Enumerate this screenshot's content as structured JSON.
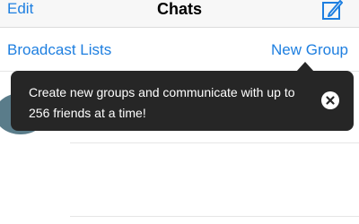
{
  "navbar": {
    "edit_label": "Edit",
    "title": "Chats",
    "compose_icon": "compose-icon"
  },
  "subbar": {
    "broadcast_label": "Broadcast Lists",
    "new_group_label": "New Group"
  },
  "tooltip": {
    "text": "Create new groups and communicate with up to 256 friends at a time!",
    "close_icon": "close-icon"
  },
  "colors": {
    "accent": "#1e7fe0",
    "tooltip_bg": "#262626",
    "avatar": "#5a7c8a"
  }
}
